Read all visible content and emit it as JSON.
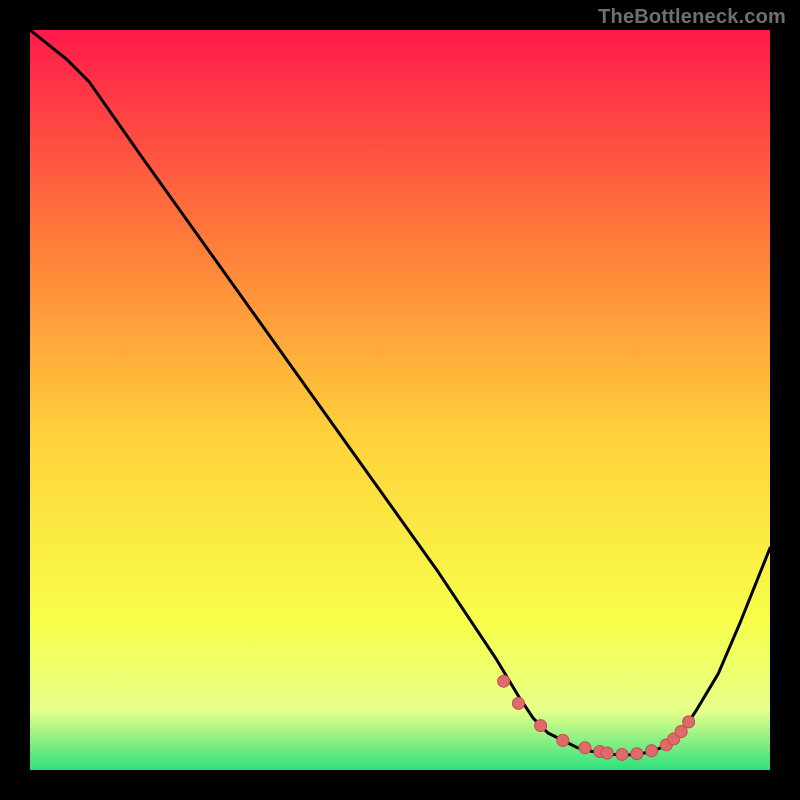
{
  "watermark": "TheBottleneck.com",
  "palette": {
    "background": "#000000",
    "grad_top": "#ff1a4b",
    "grad_mid_top": "#ff7a3a",
    "grad_mid": "#ffd23a",
    "grad_mid_low": "#f7ff4a",
    "grad_low_band_top": "#e6ff8a",
    "grad_low_band_bottom": "#2fe07d",
    "curve": "#000000",
    "marker_fill": "#e06a6a",
    "marker_stroke": "#c24f4f"
  },
  "chart_data": {
    "type": "line",
    "title": "",
    "xlabel": "",
    "ylabel": "",
    "xlim": [
      0,
      100
    ],
    "ylim": [
      0,
      100
    ],
    "series": [
      {
        "name": "bottleneck-curve",
        "x": [
          0,
          5,
          8,
          15,
          25,
          35,
          45,
          55,
          63,
          66,
          68,
          70,
          72,
          74,
          76,
          78,
          80,
          82,
          84,
          86,
          88,
          90,
          93,
          96,
          100
        ],
        "y": [
          100,
          96,
          93,
          83,
          69,
          55,
          41,
          27,
          15,
          10,
          7,
          5,
          4,
          3,
          2.5,
          2.2,
          2,
          2.1,
          2.5,
          3.3,
          5,
          8,
          13,
          20,
          30
        ]
      }
    ],
    "markers": {
      "name": "highlight-points",
      "x": [
        64,
        66,
        69,
        72,
        75,
        77,
        78,
        80,
        82,
        84,
        86,
        87,
        88,
        89
      ],
      "y": [
        12,
        9,
        6,
        4,
        3,
        2.5,
        2.3,
        2.1,
        2.2,
        2.6,
        3.4,
        4.2,
        5.2,
        6.5
      ]
    }
  }
}
